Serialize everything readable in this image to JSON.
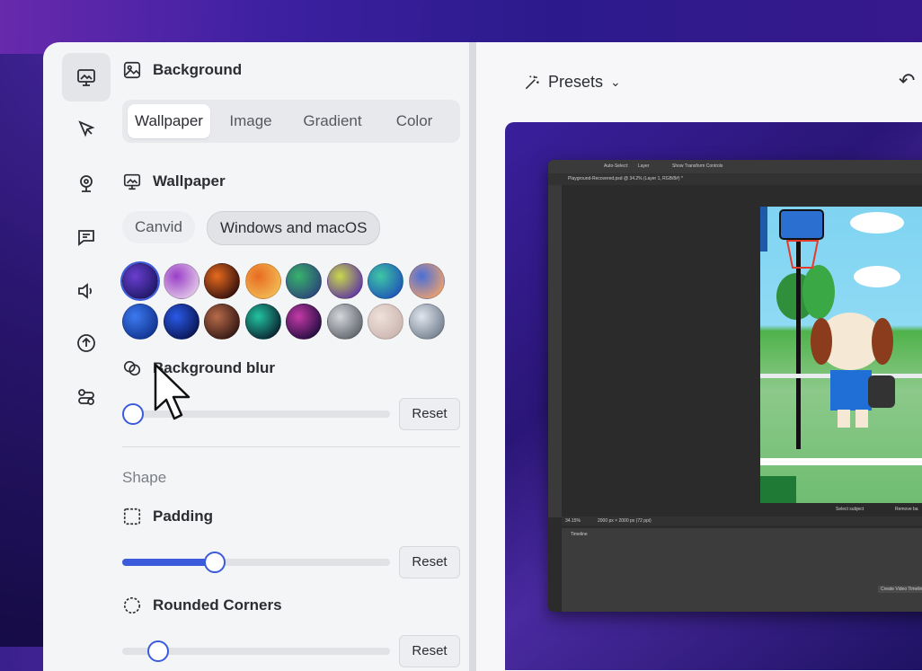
{
  "nav": {
    "items": [
      {
        "name": "background",
        "icon": "wallpaper-icon",
        "active": true
      },
      {
        "name": "cursor",
        "icon": "cursor-icon",
        "active": false
      },
      {
        "name": "camera",
        "icon": "webcam-icon",
        "active": false
      },
      {
        "name": "annotations",
        "icon": "chat-icon",
        "active": false
      },
      {
        "name": "audio",
        "icon": "speaker-icon",
        "active": false
      },
      {
        "name": "export",
        "icon": "upload-icon",
        "active": false
      },
      {
        "name": "automation",
        "icon": "flow-icon",
        "active": false
      }
    ]
  },
  "panel": {
    "background_title": "Background",
    "tabs": [
      "Wallpaper",
      "Image",
      "Gradient",
      "Color"
    ],
    "active_tab": "Wallpaper",
    "wallpaper_title": "Wallpaper",
    "chips": [
      "Canvid",
      "Windows and macOS"
    ],
    "active_chip": "Windows and macOS",
    "wallpapers": [
      {
        "name": "purple-wave",
        "colors": [
          "#1a1560",
          "#6a3fd0"
        ]
      },
      {
        "name": "pink-dune",
        "colors": [
          "#e6cfe9",
          "#9a3fc8"
        ]
      },
      {
        "name": "orange-fire",
        "colors": [
          "#2a0c0c",
          "#e86a1e"
        ]
      },
      {
        "name": "sunset-orange",
        "colors": [
          "#f3c057",
          "#e86b22"
        ]
      },
      {
        "name": "green-aurora",
        "colors": [
          "#2b3f7a",
          "#38b36b"
        ]
      },
      {
        "name": "rainbow-hills",
        "colors": [
          "#5a2ea8",
          "#c8d84a"
        ]
      },
      {
        "name": "blue-green-wave",
        "colors": [
          "#1d4fb8",
          "#3fc7a5"
        ]
      },
      {
        "name": "peach-wave",
        "colors": [
          "#f4a36a",
          "#4a6fd8"
        ]
      },
      {
        "name": "blue-swirl",
        "colors": [
          "#0e2f8a",
          "#3d7af0"
        ]
      },
      {
        "name": "deep-blue-flow",
        "colors": [
          "#08124a",
          "#2a5ae8"
        ]
      },
      {
        "name": "copper-swirl",
        "colors": [
          "#2b1410",
          "#b86a4a"
        ]
      },
      {
        "name": "teal-glow",
        "colors": [
          "#0a1a2a",
          "#22c4a0"
        ]
      },
      {
        "name": "violet-glow",
        "colors": [
          "#1a0a3a",
          "#c43aa8"
        ]
      },
      {
        "name": "silver-ribbons",
        "colors": [
          "#5a5f66",
          "#d4d7db"
        ]
      },
      {
        "name": "rose-silk",
        "colors": [
          "#c9b3ad",
          "#efe1db"
        ]
      },
      {
        "name": "glass-swirl",
        "colors": [
          "#6f7a8a",
          "#dfe6ee"
        ]
      }
    ],
    "blur_label": "Background blur",
    "blur_value": 0,
    "reset_label": "Reset",
    "shape_label": "Shape",
    "padding_label": "Padding",
    "padding_value": 0.32,
    "rounded_label": "Rounded Corners"
  },
  "right": {
    "presets_label": "Presets",
    "ps": {
      "tab_title": "Playground-Recovered.psd @ 34.2% (Layer 1, RGB/8#) *",
      "zoom": "34.15%",
      "doc_size": "2000 px × 2000 px (72 ppi)",
      "select_subject": "Select subject",
      "remove_bg": "Remove ba",
      "timeline": "Timeline",
      "create_video": "Create Video Timeline",
      "auto_select": "Auto-Select:",
      "layer": "Layer",
      "show_transform": "Show Transform Controls"
    }
  }
}
